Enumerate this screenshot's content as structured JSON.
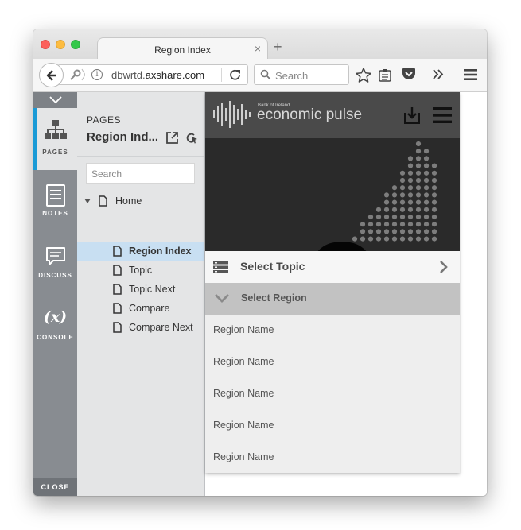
{
  "browser": {
    "tab_title": "Region Index",
    "tab_close": "×",
    "new_tab": "+",
    "url_host_prefix": "dbwrtd.",
    "url_host_domain": "axshare.com",
    "search_placeholder": "Search"
  },
  "rail": {
    "items": [
      {
        "label": "PAGES",
        "icon": "sitemap-icon",
        "active": true
      },
      {
        "label": "NOTES",
        "icon": "notes-icon",
        "active": false
      },
      {
        "label": "DISCUSS",
        "icon": "discuss-icon",
        "active": false
      },
      {
        "label": "CONSOLE",
        "icon": "console-icon",
        "active": false
      }
    ],
    "console_glyph": "(x)",
    "close_label": "CLOSE"
  },
  "pages_panel": {
    "heading": "PAGES",
    "current_page": "Region Ind...",
    "search_placeholder": "Search",
    "tree": [
      {
        "label": "Home",
        "level": 0,
        "expanded": true,
        "selected": false
      },
      {
        "label": "Region Index",
        "level": 1,
        "selected": true
      },
      {
        "label": "Topic",
        "level": 1,
        "selected": false
      },
      {
        "label": "Topic Next",
        "level": 1,
        "selected": false
      },
      {
        "label": "Compare",
        "level": 1,
        "selected": false
      },
      {
        "label": "Compare Next",
        "level": 1,
        "selected": false
      }
    ]
  },
  "prototype": {
    "brand_small": "Bank of Ireland",
    "brand": "economic pulse",
    "select_topic": "Select Topic",
    "select_region": "Select Region",
    "regions": [
      "Region Name",
      "Region Name",
      "Region Name",
      "Region Name",
      "Region Name"
    ]
  },
  "colors": {
    "accent": "#1a9ad6",
    "selected_row": "#c8dff2",
    "rail": "#888c91",
    "app_header": "#4a4a4a"
  }
}
